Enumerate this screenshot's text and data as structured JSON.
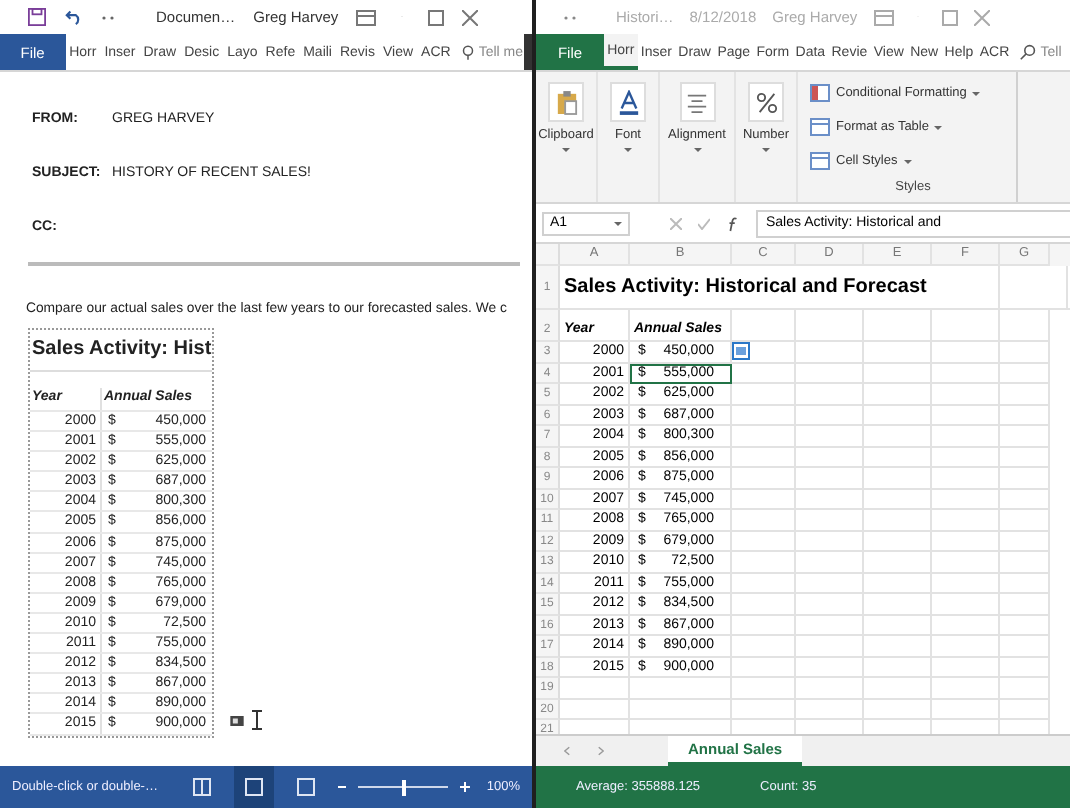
{
  "word": {
    "title_bar": {
      "title": "Documen…",
      "user": "Greg Harvey"
    },
    "tabs": [
      {
        "label": "File",
        "kind": "file"
      },
      {
        "label": "Horr",
        "kind": "tab"
      },
      {
        "label": "Inser",
        "kind": "tab"
      },
      {
        "label": "Draw",
        "kind": "tab"
      },
      {
        "label": "Desic",
        "kind": "tab"
      },
      {
        "label": "Layo",
        "kind": "tab"
      },
      {
        "label": "Refe",
        "kind": "tab"
      },
      {
        "label": "Maili",
        "kind": "tab"
      },
      {
        "label": "Revis",
        "kind": "tab"
      },
      {
        "label": "View",
        "kind": "tab"
      },
      {
        "label": "ACR",
        "kind": "tab"
      }
    ],
    "tell_me": "Tell me",
    "fields": [
      {
        "label": "FROM:",
        "value": "GREG HARVEY"
      },
      {
        "label": "SUBJECT:",
        "value": "HISTORY OF RECENT SALES!"
      },
      {
        "label": "CC:"
      }
    ],
    "paragraph": "Compare our actual sales over the last few years to our forecasted sales. We c",
    "embedded_table": {
      "title": "Sales Activity: Hist",
      "headers": [
        "Year",
        "Annual Sales"
      ],
      "rows": [
        {
          "year": "2000",
          "currency": "$",
          "amount": "450,000"
        },
        {
          "year": "2001",
          "currency": "$",
          "amount": "555,000"
        },
        {
          "year": "2002",
          "currency": "$",
          "amount": "625,000"
        },
        {
          "year": "2003",
          "currency": "$",
          "amount": "687,000"
        },
        {
          "year": "2004",
          "currency": "$",
          "amount": "800,300"
        },
        {
          "year": "2005",
          "currency": "$",
          "amount": "856,000"
        },
        {
          "year": "2006",
          "currency": "$",
          "amount": "875,000"
        },
        {
          "year": "2007",
          "currency": "$",
          "amount": "745,000"
        },
        {
          "year": "2008",
          "currency": "$",
          "amount": "765,000"
        },
        {
          "year": "2009",
          "currency": "$",
          "amount": "679,000"
        },
        {
          "year": "2010",
          "currency": "$",
          "amount": "72,500"
        },
        {
          "year": "2011",
          "currency": "$",
          "amount": "755,000"
        },
        {
          "year": "2012",
          "currency": "$",
          "amount": "834,500"
        },
        {
          "year": "2013",
          "currency": "$",
          "amount": "867,000"
        },
        {
          "year": "2014",
          "currency": "$",
          "amount": "890,000"
        },
        {
          "year": "2015",
          "currency": "$",
          "amount": "900,000"
        }
      ]
    },
    "status_bar": {
      "text": "Double-click or double-…",
      "views": [
        {
          "selected": false
        },
        {
          "selected": true
        },
        {
          "selected": false
        }
      ],
      "zoom": {
        "level": 0.5
      },
      "zoom_text": "100%"
    }
  },
  "excel": {
    "title_bar": {
      "title": "Histori…",
      "date": "8/12/2018",
      "user": "Greg Harvey"
    },
    "tabs": [
      {
        "label": "File",
        "kind": "file",
        "selected": false
      },
      {
        "label": "Horr",
        "kind": "tab",
        "selected": true
      },
      {
        "label": "Inser",
        "kind": "tab",
        "selected": false
      },
      {
        "label": "Draw",
        "kind": "tab",
        "selected": false
      },
      {
        "label": "Page",
        "kind": "tab",
        "selected": false
      },
      {
        "label": "Form",
        "kind": "tab",
        "selected": false
      },
      {
        "label": "Data",
        "kind": "tab",
        "selected": false
      },
      {
        "label": "Revie",
        "kind": "tab",
        "selected": false
      },
      {
        "label": "View",
        "kind": "tab",
        "selected": false
      },
      {
        "label": "New",
        "kind": "tab",
        "selected": false
      },
      {
        "label": "Help",
        "kind": "tab",
        "selected": false
      },
      {
        "label": "ACR",
        "kind": "tab",
        "selected": false
      }
    ],
    "tell_me": "Tell",
    "ribbon_groups": [
      {
        "label": "Clipboard",
        "kind": "clipboard"
      },
      {
        "label": "Font",
        "kind": "font"
      },
      {
        "label": "Alignment",
        "kind": "alignment"
      },
      {
        "label": "Number",
        "kind": "number"
      }
    ],
    "styles": {
      "commands": [
        {
          "label": "Conditional Formatting"
        },
        {
          "label": "Format as Table"
        },
        {
          "label": "Cell Styles"
        }
      ],
      "label": "Styles"
    },
    "name_box": "A1",
    "formula": "Sales Activity: Historical and",
    "columns": [
      "A",
      "B",
      "C",
      "D",
      "E",
      "F",
      "G"
    ],
    "rows": [
      {
        "num": "1",
        "kind": "title",
        "cells": [
          "Sales Activity: Historical and Forecast"
        ]
      },
      {
        "num": "2",
        "kind": "header",
        "cells": [
          "Year",
          "Annual Sales"
        ]
      },
      {
        "num": "3",
        "kind": "data",
        "selected": false,
        "quick_analysis": true,
        "cells": [
          "2000",
          "$",
          "450,000"
        ]
      },
      {
        "num": "4",
        "kind": "data",
        "selected": true,
        "cells": [
          "2001",
          "$",
          "555,000"
        ]
      },
      {
        "num": "5",
        "kind": "data",
        "selected": false,
        "cells": [
          "2002",
          "$",
          "625,000"
        ]
      },
      {
        "num": "6",
        "kind": "data",
        "selected": false,
        "cells": [
          "2003",
          "$",
          "687,000"
        ]
      },
      {
        "num": "7",
        "kind": "data",
        "selected": false,
        "cells": [
          "2004",
          "$",
          "800,300"
        ]
      },
      {
        "num": "8",
        "kind": "data",
        "selected": false,
        "cells": [
          "2005",
          "$",
          "856,000"
        ]
      },
      {
        "num": "9",
        "kind": "data",
        "selected": false,
        "cells": [
          "2006",
          "$",
          "875,000"
        ]
      },
      {
        "num": "10",
        "kind": "data",
        "selected": false,
        "cells": [
          "2007",
          "$",
          "745,000"
        ]
      },
      {
        "num": "11",
        "kind": "data",
        "selected": false,
        "cells": [
          "2008",
          "$",
          "765,000"
        ]
      },
      {
        "num": "12",
        "kind": "data",
        "selected": false,
        "cells": [
          "2009",
          "$",
          "679,000"
        ]
      },
      {
        "num": "13",
        "kind": "data",
        "selected": false,
        "cells": [
          "2010",
          "$",
          "72,500"
        ]
      },
      {
        "num": "14",
        "kind": "data",
        "selected": false,
        "cells": [
          "2011",
          "$",
          "755,000"
        ]
      },
      {
        "num": "15",
        "kind": "data",
        "selected": false,
        "cells": [
          "2012",
          "$",
          "834,500"
        ]
      },
      {
        "num": "16",
        "kind": "data",
        "selected": false,
        "cells": [
          "2013",
          "$",
          "867,000"
        ]
      },
      {
        "num": "17",
        "kind": "data",
        "selected": false,
        "cells": [
          "2014",
          "$",
          "890,000"
        ]
      },
      {
        "num": "18",
        "kind": "data",
        "selected": false,
        "cells": [
          "2015",
          "$",
          "900,000"
        ]
      },
      {
        "num": "19",
        "kind": "empty",
        "cells": []
      },
      {
        "num": "20",
        "kind": "empty",
        "cells": []
      },
      {
        "num": "21",
        "kind": "empty",
        "cells": []
      }
    ],
    "sheet_tabs": [
      {
        "label": "Annual Sales",
        "selected": true
      }
    ],
    "status_bar": {
      "average": "Average: 355888.125",
      "count": "Count: 35"
    }
  }
}
